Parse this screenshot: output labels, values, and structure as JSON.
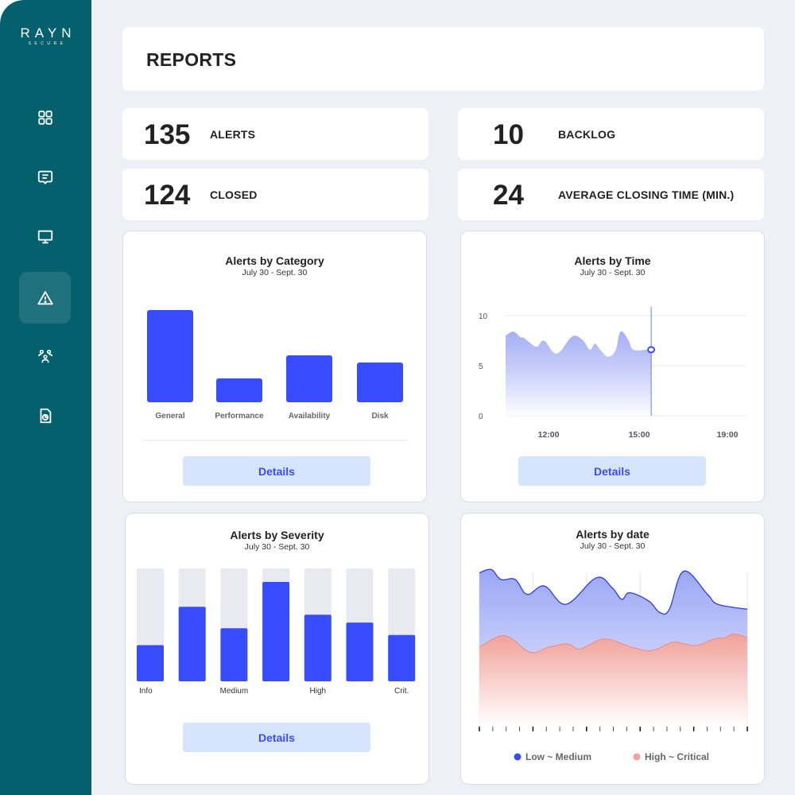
{
  "brand": {
    "name": "RAYN",
    "tagline": "SECURE"
  },
  "sidebar": {
    "items": [
      {
        "icon": "dashboard-grid-icon",
        "label": "Dashboard",
        "active": false
      },
      {
        "icon": "chat-message-icon",
        "label": "Messages",
        "active": false
      },
      {
        "icon": "monitor-icon",
        "label": "Devices",
        "active": false
      },
      {
        "icon": "alert-triangle-icon",
        "label": "Alerts",
        "active": true
      },
      {
        "icon": "users-group-icon",
        "label": "Users",
        "active": false
      },
      {
        "icon": "report-file-icon",
        "label": "Reports",
        "active": false
      }
    ]
  },
  "header": {
    "title": "REPORTS"
  },
  "stats": [
    {
      "value": "135",
      "label": "ALERTS"
    },
    {
      "value": "10",
      "label": "BACKLOG"
    },
    {
      "value": "124",
      "label": "CLOSED"
    },
    {
      "value": "24",
      "label": "AVERAGE CLOSING TIME (MIN.)"
    }
  ],
  "colors": {
    "sidebar": "#03606c",
    "accent": "#374bff",
    "button_bg": "#d6e4fd",
    "high_critical": "#f0a19a",
    "track": "#e8eaef"
  },
  "chart_data": [
    {
      "id": "category",
      "type": "bar",
      "title": "Alerts by Category",
      "subtitle": "July 30 - Sept. 30",
      "categories": [
        "General",
        "Performance",
        "Availability",
        "Disk"
      ],
      "values": [
        116,
        30,
        59,
        50
      ],
      "ylim": [
        0,
        120
      ],
      "button": "Details"
    },
    {
      "id": "time",
      "type": "area",
      "title": "Alerts by Time",
      "subtitle": "July 30 - Sept. 30",
      "ylim": [
        0,
        10
      ],
      "yticks": [
        "10",
        "5",
        "0"
      ],
      "xtick_labels": [
        "12:00",
        "15:00",
        "19:00"
      ],
      "x": [
        0,
        0.3,
        0.6,
        0.7,
        1.2,
        1.5,
        2.0,
        2.6,
        3.0,
        3.3,
        3.5,
        3.7,
        4.0,
        4.3,
        4.5,
        4.8,
        5.0,
        5.5,
        5.7
      ],
      "values": [
        8.0,
        8.4,
        7.8,
        7.8,
        6.9,
        7.5,
        6.2,
        7.9,
        7.6,
        6.6,
        7.2,
        6.6,
        5.9,
        6.5,
        8.4,
        7.6,
        6.6,
        6.6,
        6.6
      ],
      "x_range": [
        0,
        9.4
      ],
      "cursor_x": 5.7,
      "cursor_value": 6.6,
      "button": "Details"
    },
    {
      "id": "severity",
      "type": "bar",
      "title": "Alerts by Severity",
      "subtitle": "July 30 - Sept. 30",
      "categories": [
        "Info",
        "",
        "Medium",
        "",
        "High",
        "",
        "Crit."
      ],
      "values": [
        32,
        66,
        47,
        88,
        59,
        52,
        41
      ],
      "ylim": [
        0,
        100
      ],
      "button": "Details"
    },
    {
      "id": "date",
      "type": "area",
      "title": "Alerts by date",
      "subtitle": "July 30 - Sept. 30",
      "x_count": 21,
      "series": [
        {
          "name": "Low ~ Medium",
          "color": "#2b3cf0",
          "values": [
            90,
            95,
            88,
            89,
            78,
            84,
            72,
            80,
            86,
            90,
            85,
            74,
            81,
            74,
            68,
            75,
            93,
            86,
            78,
            72,
            70
          ],
          "x": [
            0,
            1,
            1.6,
            2.7,
            3.7,
            5.1,
            7.1,
            8.5,
            10,
            11.7,
            12.6,
            13.3,
            13.7,
            15.6,
            15.9,
            17.2,
            18.2,
            19.7,
            20,
            20,
            20
          ]
        },
        {
          "name": "High ~ Critical",
          "color": "#f0a19a",
          "values": [
            38,
            46,
            50,
            42,
            39,
            42,
            44,
            41,
            47,
            48,
            44,
            39,
            45,
            45,
            43,
            48,
            47,
            50,
            48
          ]
        }
      ],
      "ylim": [
        0,
        100
      ],
      "legend": "bottom"
    }
  ]
}
